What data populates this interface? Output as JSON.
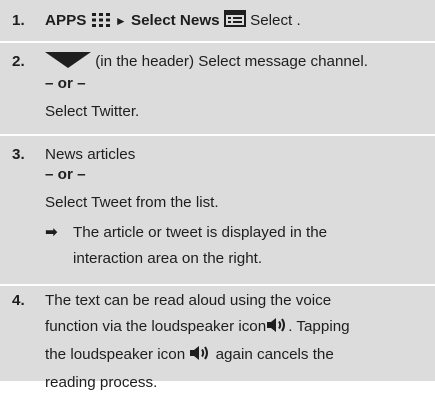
{
  "steps": [
    {
      "number": "1.",
      "apps_label": "APPS",
      "arrow_glyph": "►",
      "select_news_label": "Select News",
      "select_suffix": " Select ."
    },
    {
      "number": "2.",
      "header_text": " (in the header) Select message channel.",
      "or_text": "– or –",
      "alt_text": "Select Twitter."
    },
    {
      "number": "3.",
      "text": "News articles",
      "or_text": "– or –",
      "alt_text": "Select Tweet from the list.",
      "result_glyph": "➡",
      "result_line1": "The article or tweet is displayed in the",
      "result_line2": "interaction area on the right."
    },
    {
      "number": "4.",
      "line1": "The text can be read aloud using the voice",
      "line2_before": "function via the loudspeaker icon",
      "line2_after": ". Tapping",
      "line3_before": "the loudspeaker icon ",
      "line3_after": " again cancels the",
      "line4": "reading process."
    }
  ],
  "icons": {
    "apps": "apps-grid-icon",
    "news": "news-list-icon",
    "dropdown": "dropdown-triangle-icon",
    "speaker": "loudspeaker-icon"
  }
}
